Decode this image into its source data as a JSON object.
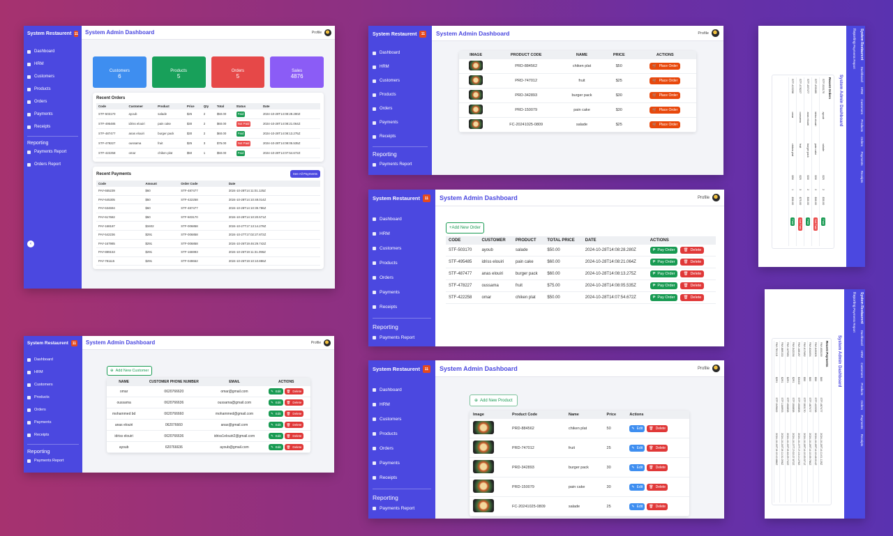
{
  "app": {
    "brand": "System Restaurent",
    "brand_badge": "🍴",
    "title": "System Admin Dashboard",
    "profile": "Profile"
  },
  "nav": {
    "dashboard": "Dashboard",
    "hrm": "HRM",
    "customers": "Customers",
    "products": "Products",
    "orders": "Orders",
    "payments": "Payments",
    "receipts": "Receipts",
    "reporting": "Reporting",
    "payments_report": "Payments Report",
    "orders_report": "Orders Report"
  },
  "stats": [
    {
      "label": "Customers",
      "value": "6",
      "color": "#3e8ef0"
    },
    {
      "label": "Products",
      "value": "5",
      "color": "#18a05a"
    },
    {
      "label": "Orders",
      "value": "5",
      "color": "#e64848"
    },
    {
      "label": "Sales",
      "value": "4876",
      "color": "#8b5cf6"
    }
  ],
  "recent_orders": {
    "title": "Recent Orders",
    "headers": [
      "Code",
      "Customer",
      "Product",
      "Price",
      "Qty",
      "Total",
      "Status",
      "Date"
    ],
    "rows": [
      [
        "STF-503170",
        "ayoub",
        "salade",
        "$25",
        "2",
        "$50.00",
        "Paid",
        "2024-10-28T14:08:28.280Z"
      ],
      [
        "STF-495485",
        "idriss elouiri",
        "pain cake",
        "$30",
        "2",
        "$60.00",
        "Not Paid",
        "2024-10-28T14:08:21.064Z"
      ],
      [
        "STF-487477",
        "anas elouiri",
        "burger pack",
        "$30",
        "2",
        "$60.00",
        "Paid",
        "2024-10-28T14:08:13.275Z"
      ],
      [
        "STF-478227",
        "oussama",
        "fruit",
        "$25",
        "3",
        "$75.00",
        "Not Paid",
        "2024-10-28T14:08:05.535Z"
      ],
      [
        "STF-422258",
        "omar",
        "chiken plat",
        "$50",
        "1",
        "$50.00",
        "Paid",
        "2024-10-28T14:07:54.672Z"
      ]
    ]
  },
  "recent_payments": {
    "title": "Recent Payments",
    "see_all": "See All Payments",
    "headers": [
      "Code",
      "Amount",
      "Order Code",
      "Date"
    ],
    "rows": [
      [
        "PAY-655239",
        "$60",
        "STF-487477",
        "2024-10-28T14:11:01.125Z"
      ],
      [
        "PAY-645305",
        "$50",
        "STF-422258",
        "2024-10-28T14:10:48.014Z"
      ],
      [
        "PAY-634694",
        "$60",
        "STF-487477",
        "2024-10-28T14:10:39.786Z"
      ],
      [
        "PAY-617682",
        "$50",
        "STF-503170",
        "2024-10-28T14:10:20.571Z"
      ],
      [
        "PAY-168187",
        "$3402",
        "STF-006858",
        "2024-10-27T17:13:14.278Z"
      ],
      [
        "PAY-542236",
        "$291",
        "STF-006858",
        "2024-10-27T17:02:27.872Z"
      ],
      [
        "PAY-167985",
        "$291",
        "STF-006858",
        "2024-10-26T19:46:29.742Z"
      ],
      [
        "PAY-889153",
        "$291",
        "STF-166993",
        "2024-10-26T19:11:31.096Z"
      ],
      [
        "PAY-781115",
        "$291",
        "STF-049662",
        "2024-10-26T19:10:10.886Z"
      ]
    ]
  },
  "products_order": {
    "headers": [
      "IMAGE",
      "PRODUCT CODE",
      "NAME",
      "PRICE",
      "ACTIONS"
    ],
    "place": "Place Order",
    "rows": [
      [
        "PRD-884562",
        "chiken plat",
        "$50"
      ],
      [
        "PRD-747012",
        "fruit",
        "$25"
      ],
      [
        "PRD-342893",
        "burger pack",
        "$30"
      ],
      [
        "PRD-150079",
        "pain cake",
        "$30"
      ],
      [
        "FC-20241025-0809",
        "salade",
        "$25"
      ]
    ]
  },
  "orders": {
    "add": "+Add New Order",
    "headers": [
      "CODE",
      "CUSTOMER",
      "PRODUCT",
      "TOTAL PRICE",
      "DATE",
      "ACTIONS"
    ],
    "pay": "Pay Order",
    "del": "Delete",
    "rows": [
      [
        "STF-503170",
        "ayoub",
        "salade",
        "$50.00",
        "2024-10-28T14:08:28.280Z"
      ],
      [
        "STF-495485",
        "idriss elouiri",
        "pain cake",
        "$60.00",
        "2024-10-28T14:08:21.064Z"
      ],
      [
        "STF-487477",
        "anas elouiri",
        "burger pack",
        "$60.00",
        "2024-10-28T14:08:13.275Z"
      ],
      [
        "STF-478227",
        "oussama",
        "fruit",
        "$75.00",
        "2024-10-28T14:08:05.535Z"
      ],
      [
        "STF-422258",
        "omar",
        "chiken plat",
        "$50.00",
        "2024-10-28T14:07:54.672Z"
      ]
    ]
  },
  "customers": {
    "add": "Add New Customer",
    "headers": [
      "NAME",
      "CUSTOMER PHONE NUMBER",
      "EMAIL",
      "ACTIONS"
    ],
    "edit": "Edit",
    "del": "Delete",
    "rows": [
      [
        "omar",
        "0620766620",
        "omar@gmail.com"
      ],
      [
        "oussama",
        "0620766636",
        "oussama@gmail.com"
      ],
      [
        "mohammed bd",
        "0620766660",
        "mohammed@gmail.com"
      ],
      [
        "anas elouiri",
        "062076660",
        "anas@gmail.com"
      ],
      [
        "idriss elouiri",
        "0620766636",
        "idriss1elouiri2@gmail.com"
      ],
      [
        "ayoub",
        "620766636",
        "ayoub@gmail.com"
      ]
    ]
  },
  "products": {
    "add": "Add New Product",
    "headers": [
      "Image",
      "Product Code",
      "Name",
      "Price",
      "Actions"
    ],
    "edit": "Edit",
    "del": "Delete",
    "rows": [
      [
        "PRD-884562",
        "chiken plat",
        "50"
      ],
      [
        "PRD-747012",
        "fruit",
        "25"
      ],
      [
        "PRD-342893",
        "burger pack",
        "30"
      ],
      [
        "PRD-150079",
        "pain cake",
        "30"
      ],
      [
        "FC-20241025-0809",
        "salade",
        "25"
      ]
    ]
  }
}
